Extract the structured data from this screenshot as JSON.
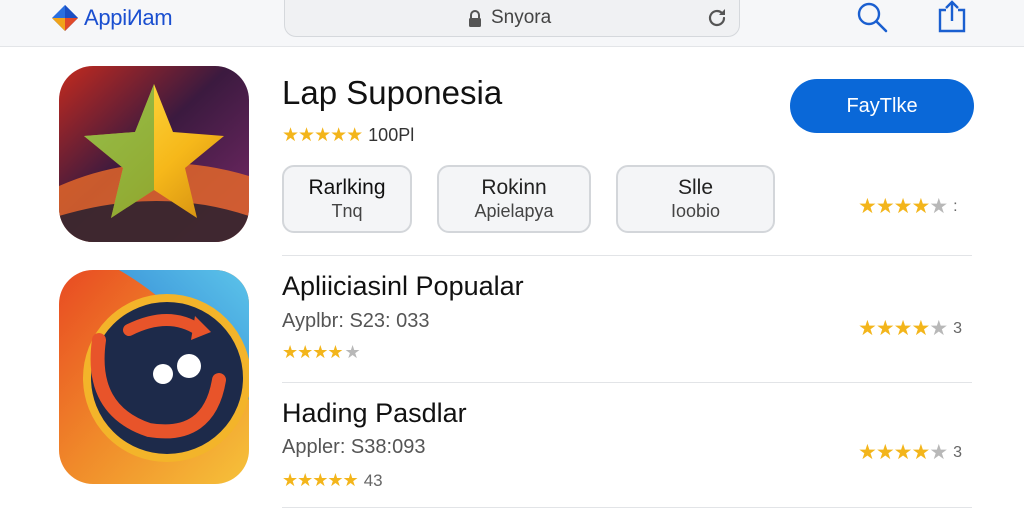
{
  "header": {
    "brand": "AppiИam",
    "url": "Snyora",
    "icons": [
      "brand-logo-icon",
      "lock-icon",
      "reload-icon",
      "search-icon",
      "share-icon"
    ]
  },
  "featured": {
    "title": "Lap Suponesia",
    "stars": "★★★★★",
    "rating_text": "100Pl",
    "get_label": "FayTlke",
    "chips": [
      {
        "title": "Rarlking",
        "sub": "Tnq"
      },
      {
        "title": "Rokinn",
        "sub": "Apielapya"
      },
      {
        "title": "Slle",
        "sub": "Ioobio"
      }
    ],
    "side_rating": {
      "stars_filled": "★★★★",
      "stars_empty": "★",
      "count": ":"
    }
  },
  "list": [
    {
      "title": "Apliiciasinl Popualar",
      "price": "Ayplbr: S23: 033",
      "stars_filled": "★★★★",
      "stars_empty": "★",
      "count": "",
      "side_filled": "★★★★",
      "side_empty": "★",
      "side_count": "3"
    },
    {
      "title": "Hading Pasdlar",
      "price": "Appler: S38:093",
      "stars_filled": "★★★★★",
      "stars_empty": "",
      "count": "43",
      "side_filled": "★★★★",
      "side_empty": "★",
      "side_count": "3"
    }
  ],
  "colors": {
    "accent": "#0a68d8",
    "star": "#f3b51b",
    "star_empty": "#b8b8b8"
  }
}
